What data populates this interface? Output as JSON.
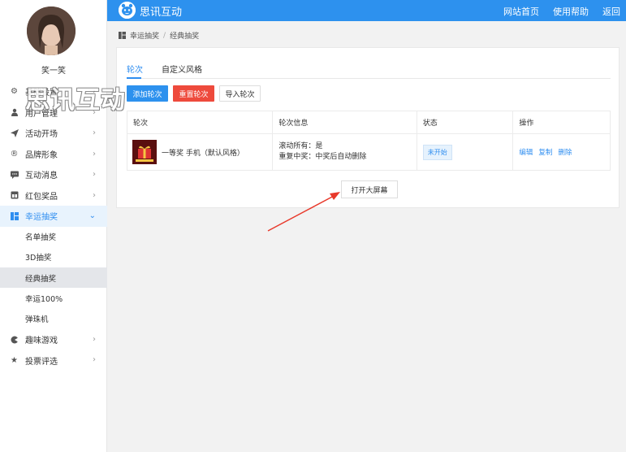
{
  "sidebar": {
    "username": "笑一笑",
    "menu": [
      {
        "label": "基础设置",
        "icon": "gear-icon"
      },
      {
        "label": "用户管理",
        "icon": "user-icon"
      },
      {
        "label": "活动开场",
        "icon": "send-icon"
      },
      {
        "label": "品牌形象",
        "icon": "registered-icon"
      },
      {
        "label": "互动消息",
        "icon": "message-icon"
      },
      {
        "label": "红包奖品",
        "icon": "gift-icon"
      },
      {
        "label": "幸运抽奖",
        "icon": "dashboard-icon"
      }
    ],
    "submenu": [
      "名单抽奖",
      "3D抽奖",
      "经典抽奖",
      "幸运100%",
      "弹珠机"
    ],
    "menu_after": [
      {
        "label": "趣味游戏",
        "icon": "game-icon"
      },
      {
        "label": "投票评选",
        "icon": "star-icon"
      }
    ]
  },
  "watermark": "思讯互动",
  "header": {
    "brand": "思讯互动",
    "nav": [
      "网站首页",
      "使用帮助",
      "返回"
    ]
  },
  "breadcrumb": [
    "幸运抽奖",
    "/",
    "经典抽奖"
  ],
  "tabs": [
    "轮次",
    "自定义风格"
  ],
  "buttons": {
    "add": "添加轮次",
    "reset": "重置轮次",
    "import": "导入轮次"
  },
  "table": {
    "headers": [
      "轮次",
      "轮次信息",
      "状态",
      "操作"
    ],
    "rows": [
      {
        "name": "一等奖 手机（默认风格）",
        "info1": "滚动所有：是",
        "info2": "重复中奖：中奖后自动删除",
        "status": "未开始",
        "ops": [
          "编辑",
          "复制",
          "删除"
        ]
      }
    ]
  },
  "big_screen_button": "打开大屏幕",
  "colors": {
    "accent": "#2d91ee",
    "danger": "#ee4a3c",
    "annotation_arrow": "#e8392b"
  }
}
